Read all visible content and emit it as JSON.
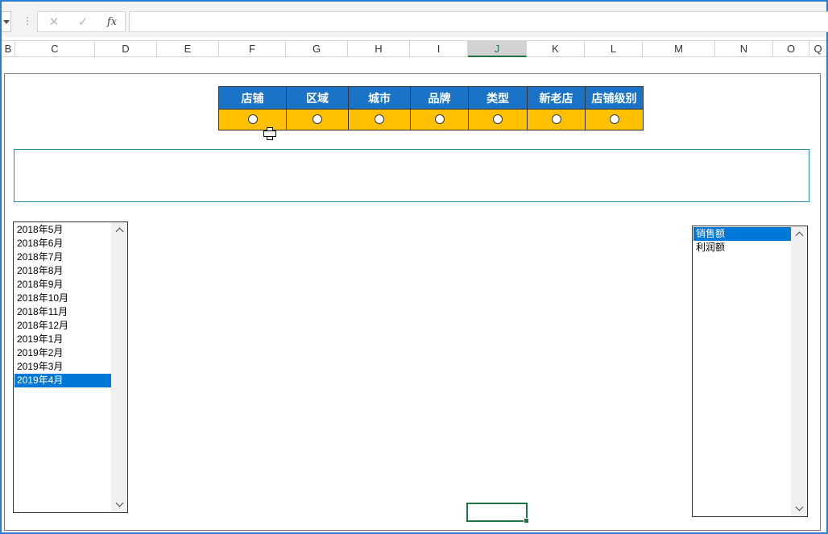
{
  "formula_bar": {
    "cancel_icon": "cross-icon",
    "enter_icon": "check-icon",
    "fx_label": "fx",
    "value": ""
  },
  "columns": [
    {
      "letter": "B"
    },
    {
      "letter": "C"
    },
    {
      "letter": "D"
    },
    {
      "letter": "E"
    },
    {
      "letter": "F"
    },
    {
      "letter": "G"
    },
    {
      "letter": "H"
    },
    {
      "letter": "I"
    },
    {
      "letter": "J"
    },
    {
      "letter": "K"
    },
    {
      "letter": "L"
    },
    {
      "letter": "M"
    },
    {
      "letter": "N"
    },
    {
      "letter": "O"
    },
    {
      "letter": "Q"
    }
  ],
  "selected_column": "J",
  "dimension_table": {
    "headers": [
      "店铺",
      "区域",
      "城市",
      "品牌",
      "类型",
      "新老店",
      "店铺级别"
    ],
    "header_bg": "#1a73c6",
    "row_bg": "#ffc000"
  },
  "month_list": {
    "items": [
      "2018年5月",
      "2018年6月",
      "2018年7月",
      "2018年8月",
      "2018年9月",
      "2018年10月",
      "2018年11月",
      "2018年12月",
      "2019年1月",
      "2019年2月",
      "2019年3月",
      "2019年4月"
    ],
    "selected": "2019年4月"
  },
  "metric_list": {
    "items": [
      "销售额",
      "利润额"
    ],
    "selected": "销售额"
  },
  "colors": {
    "accent": "#2b7cd3",
    "selection": "#0078d7",
    "active_cell": "#217346"
  }
}
